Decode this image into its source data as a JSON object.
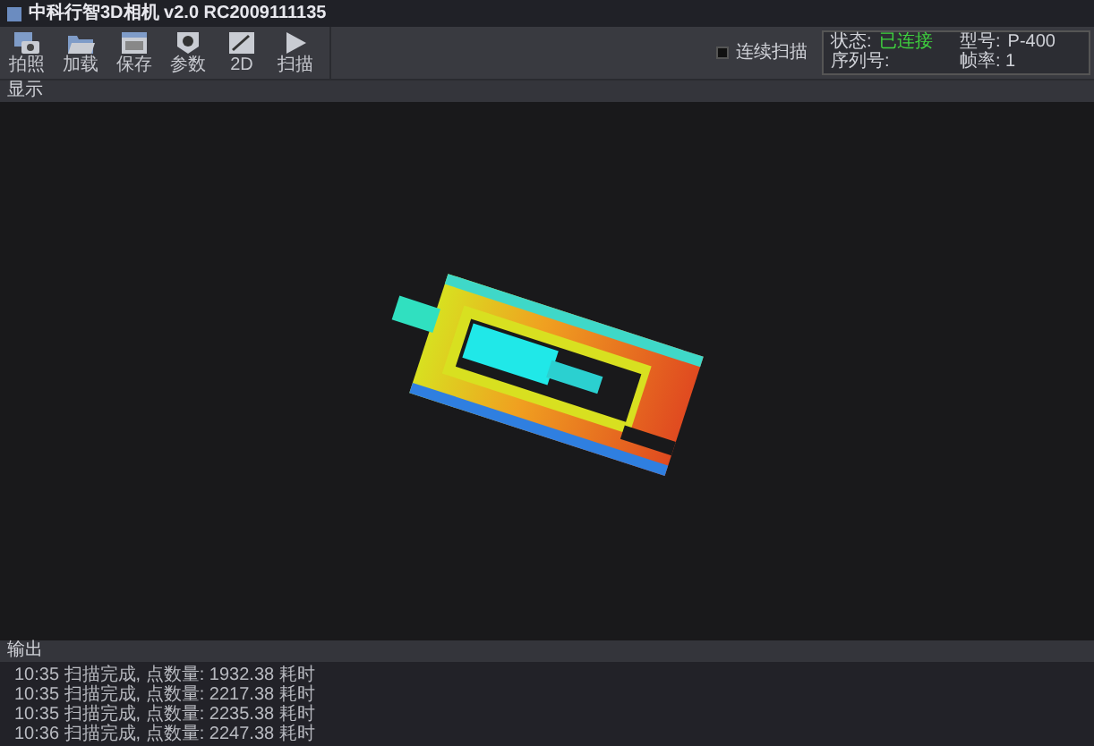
{
  "window": {
    "title": "中科行智3D相机 v2.0 RC2009111135"
  },
  "toolbar": [
    {
      "label": "拍照",
      "kind": "camera"
    },
    {
      "label": "加载",
      "kind": "open"
    },
    {
      "label": "保存",
      "kind": "save"
    },
    {
      "label": "参数",
      "kind": "lens"
    },
    {
      "label": "2D",
      "kind": "image"
    },
    {
      "label": "扫描",
      "kind": "play"
    }
  ],
  "continuous": {
    "label": "连续扫描",
    "checked": false
  },
  "status": {
    "state_label": "状态:",
    "state_value": "已连接",
    "model_label": "型号:",
    "model_value": "P-400",
    "serial_label": "序列号:",
    "frame_label": "帧率: 1"
  },
  "display": {
    "title": "显示"
  },
  "output": {
    "title": "输出",
    "lines": [
      "10:35 扫描完成, 点数量: 1932.38 耗时",
      "10:35 扫描完成, 点数量: 2217.38 耗时",
      "10:35 扫描完成, 点数量: 2235.38 耗时",
      "10:36 扫描完成, 点数量: 2247.38 耗时"
    ]
  }
}
